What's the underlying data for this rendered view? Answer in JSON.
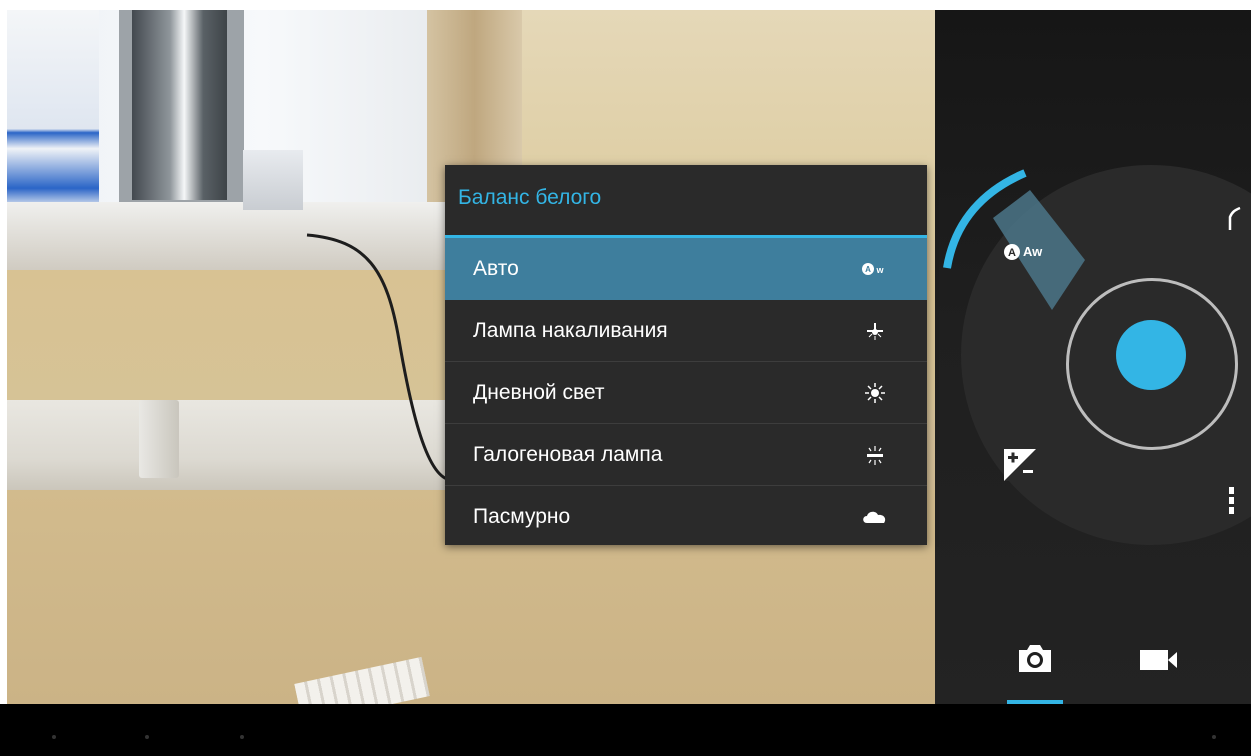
{
  "menu": {
    "title": "Баланс белого",
    "items": [
      {
        "label": "Авто",
        "icon": "auto-wb-icon",
        "icon_text": "Aw",
        "selected": true
      },
      {
        "label": "Лампа накаливания",
        "icon": "incandescent-icon",
        "selected": false
      },
      {
        "label": "Дневной свет",
        "icon": "daylight-icon",
        "selected": false
      },
      {
        "label": "Галогеновая лампа",
        "icon": "fluorescent-icon",
        "selected": false
      },
      {
        "label": "Пасмурно",
        "icon": "cloud-icon",
        "selected": false
      }
    ]
  },
  "pie": {
    "white_balance_label": "Aw",
    "icons": [
      "auto-wb-icon",
      "exposure-icon",
      "more-options-icon",
      "back-arc-icon"
    ]
  },
  "modes": {
    "photo": "camera-icon",
    "video": "video-icon",
    "active": "photo"
  },
  "colors": {
    "accent": "#33b5e5",
    "menu_selected": "#3e7e9d",
    "menu_bg": "#2a2a2a"
  }
}
